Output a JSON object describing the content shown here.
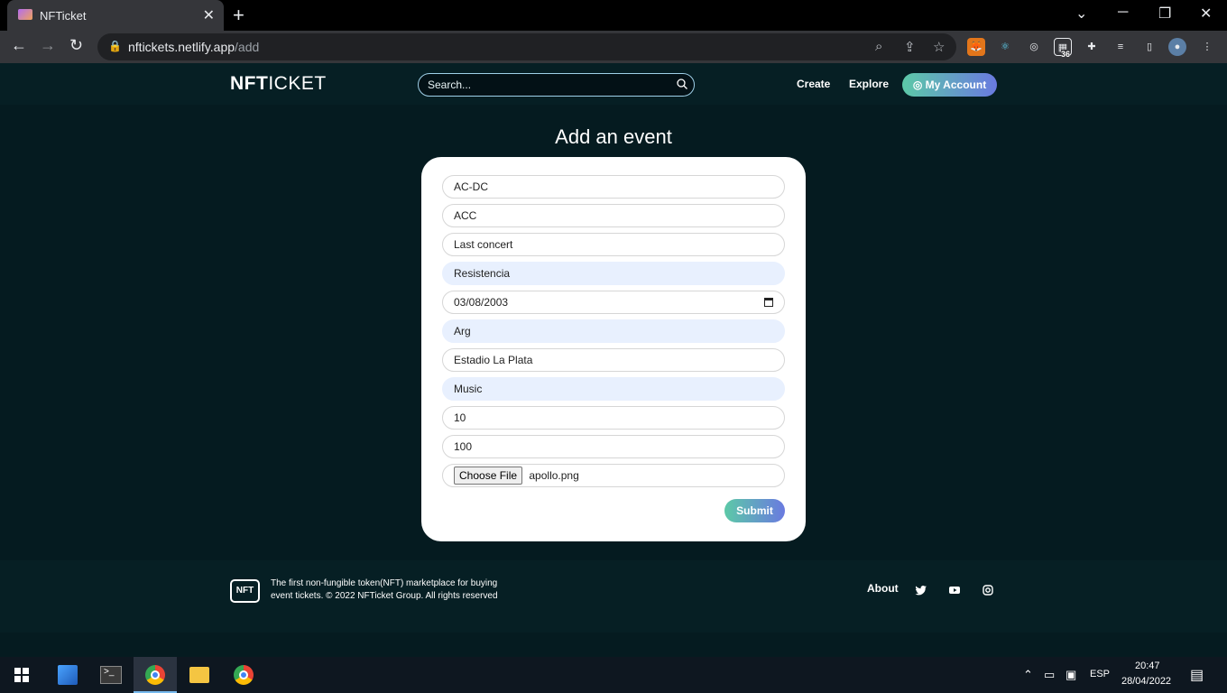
{
  "browser": {
    "tab_title": "NFTicket",
    "url_host": "nftickets.netlify.app",
    "url_path": "/add",
    "extension_badge": "36"
  },
  "header": {
    "logo_bold": "NFT",
    "logo_rest": "ICKET",
    "search_placeholder": "Search...",
    "nav": {
      "create": "Create",
      "explore": "Explore",
      "account": "My Account"
    }
  },
  "form": {
    "title": "Add an event",
    "fields": [
      {
        "value": "AC-DC"
      },
      {
        "value": "ACC"
      },
      {
        "value": "Last concert"
      },
      {
        "value": "Resistencia"
      },
      {
        "value": "03/08/2003"
      },
      {
        "value": "Arg"
      },
      {
        "value": "Estadio La Plata"
      },
      {
        "value": "Music"
      },
      {
        "value": "10"
      },
      {
        "value": "100"
      }
    ],
    "file_button": "Choose File",
    "file_name": "apollo.png",
    "submit_label": "Submit"
  },
  "footer": {
    "logo_text": "NFT",
    "line1": "The first non-fungible token(NFT) marketplace for buying",
    "line2": "event tickets. © 2022 NFTicket Group. All rights reserved",
    "about": "About"
  },
  "taskbar": {
    "language": "ESP",
    "time": "20:47",
    "date": "28/04/2022"
  },
  "colors": {
    "page_bg": "#051b20",
    "header_bg": "#061f24",
    "accent_gradient_start": "#5cc9a7",
    "accent_gradient_end": "#6a7ae0",
    "autofill_bg": "#e8f0fe"
  }
}
